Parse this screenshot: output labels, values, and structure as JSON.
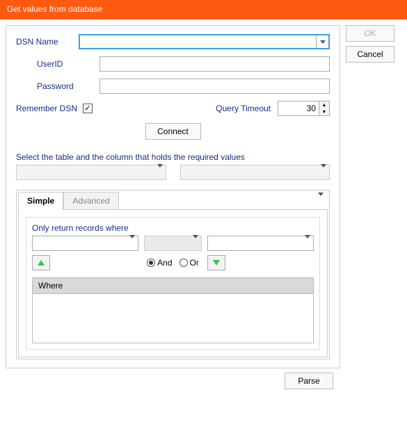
{
  "title": "Get values from database",
  "buttons": {
    "ok": "OK",
    "cancel": "Cancel",
    "connect": "Connect",
    "parse": "Parse"
  },
  "labels": {
    "dsn": "DSN Name",
    "user": "UserID",
    "pass": "Password",
    "remember": "Remember DSN",
    "timeout": "Query Timeout",
    "selectTable": "Select the table and the column that holds the required values",
    "onlyReturn": "Only return records where",
    "and": "And",
    "or": "Or",
    "where": "Where"
  },
  "values": {
    "dsn": "",
    "user": "",
    "pass": "",
    "remember": true,
    "timeout": "30",
    "logic": "and"
  },
  "tabs": {
    "simple": "Simple",
    "advanced": "Advanced",
    "active": "simple"
  }
}
